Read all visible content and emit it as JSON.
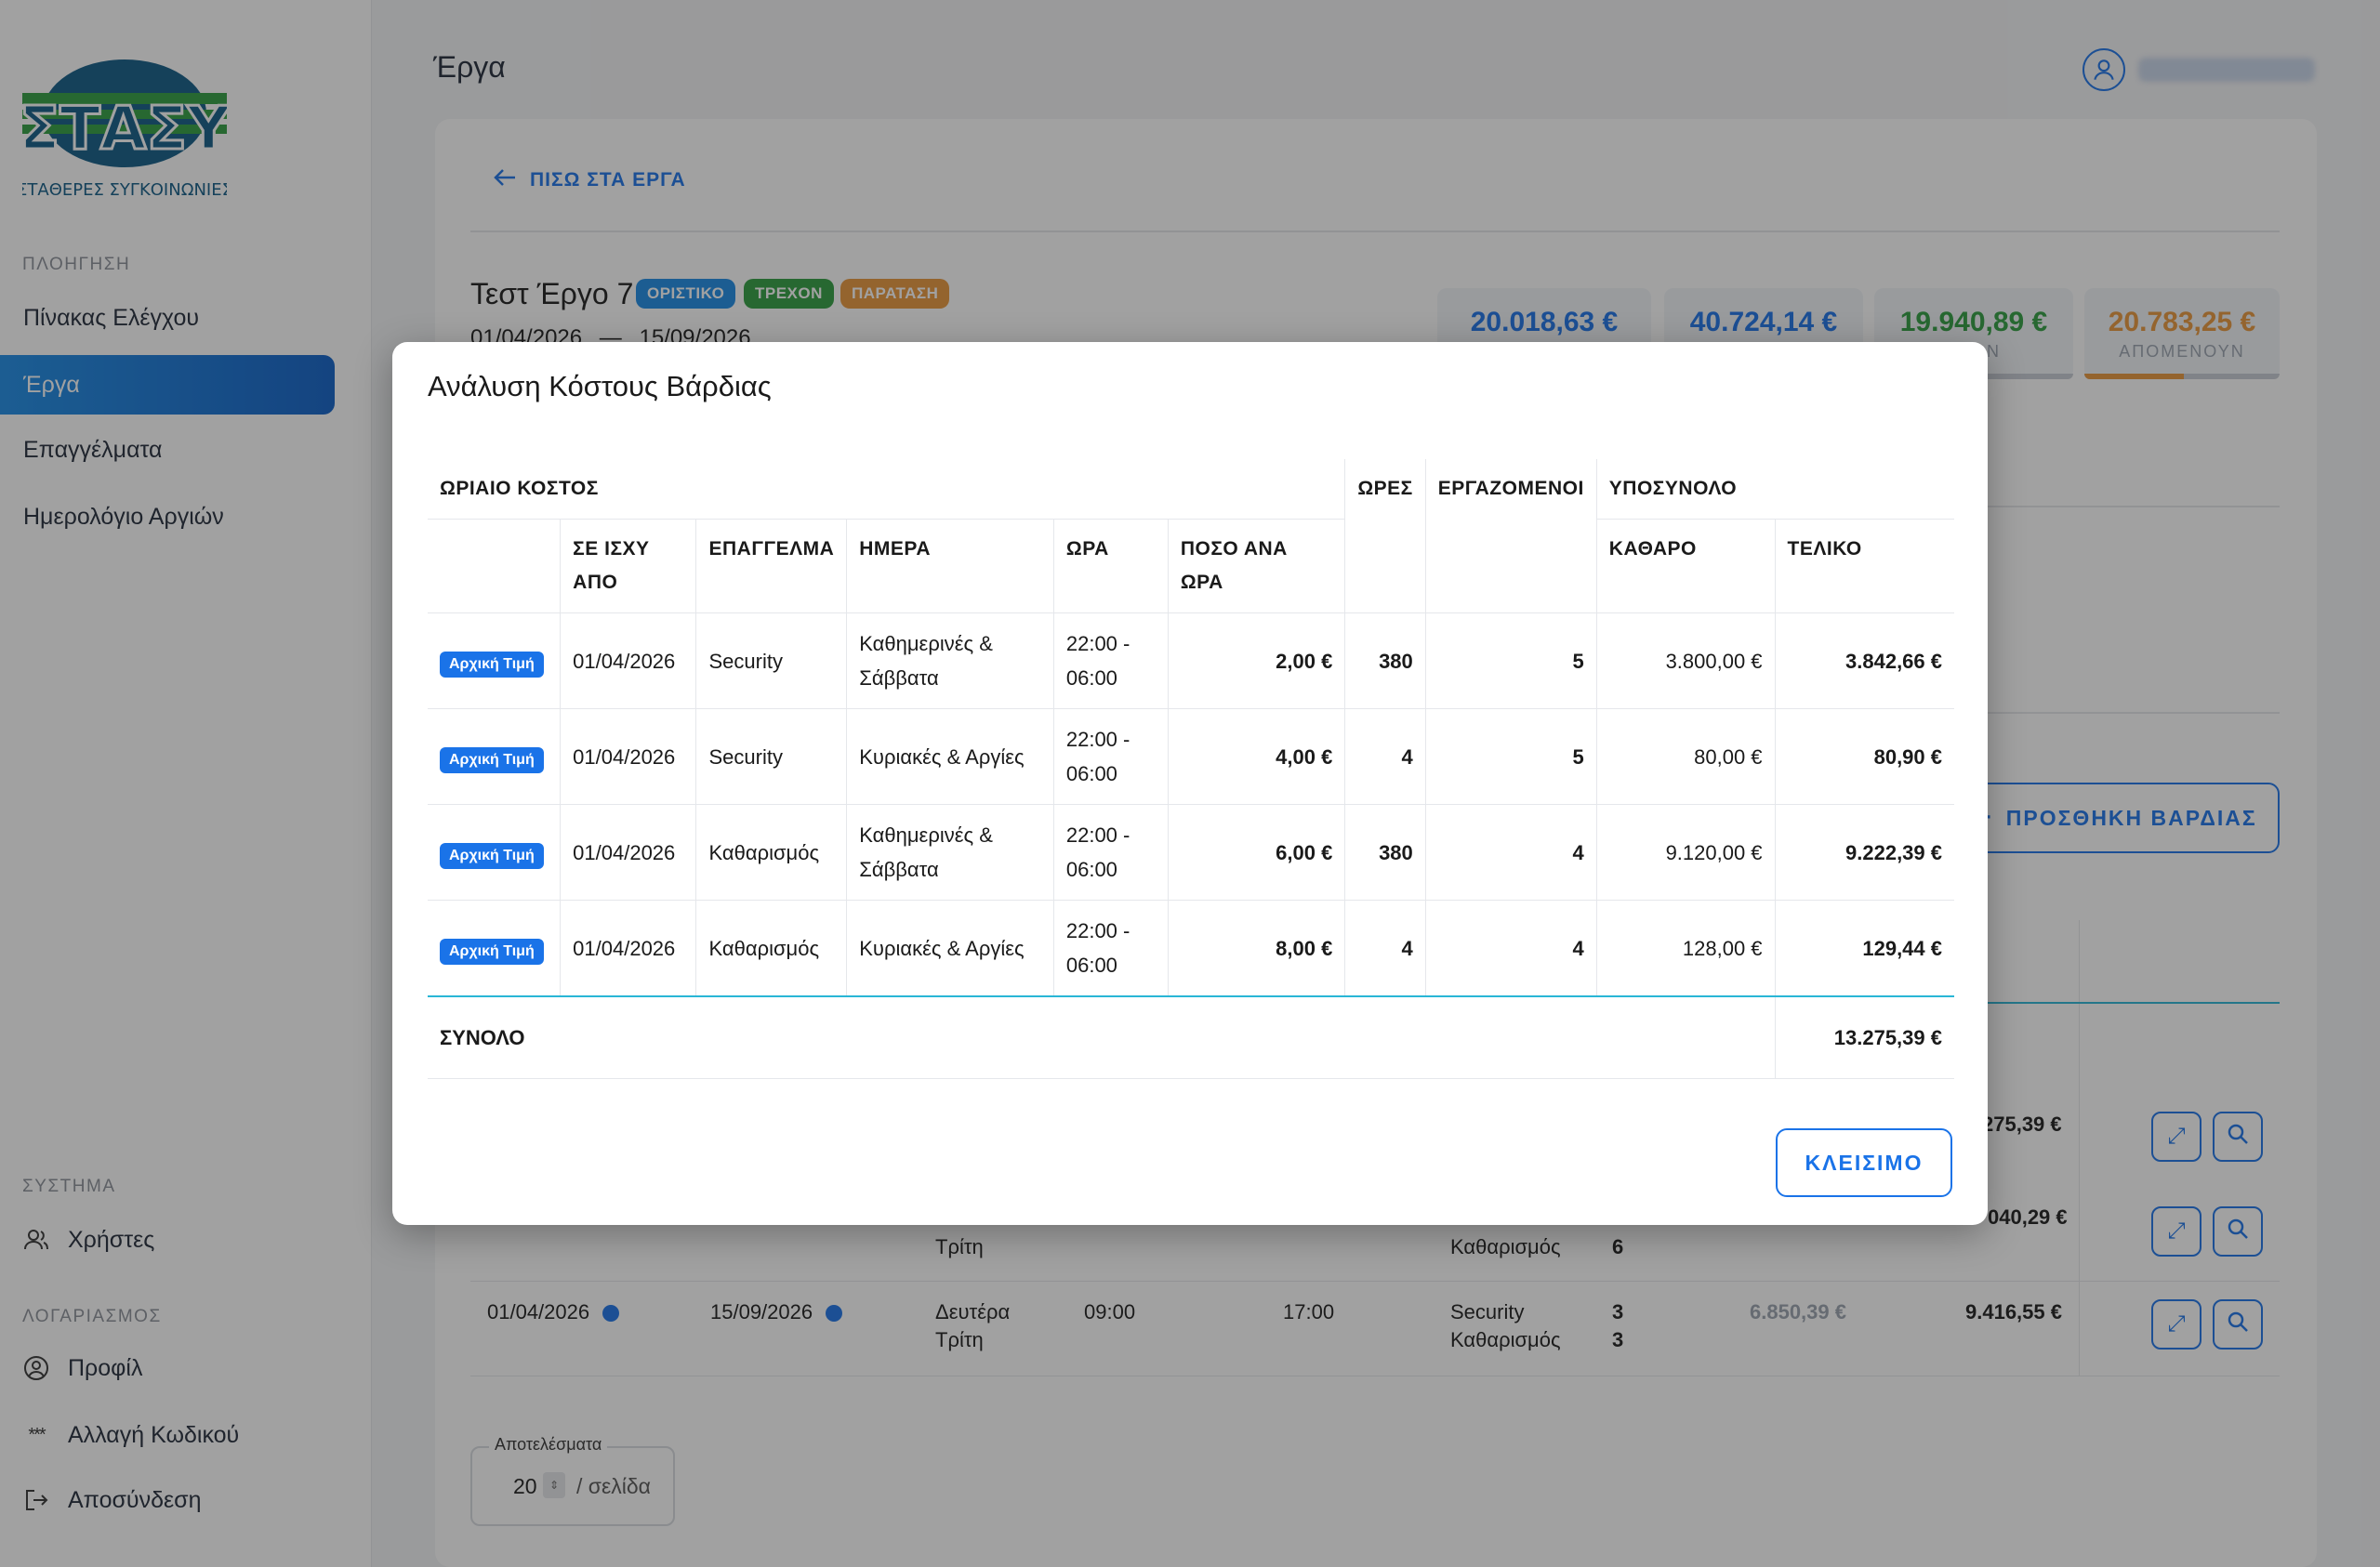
{
  "sidebar": {
    "logo_text": "ΣΤΑΣΥ",
    "logo_subtitle": "ΣΤΑΘΕΡΕΣ ΣΥΓΚΟΙΝΩΝΙΕΣ",
    "nav_section": "ΠΛΟΗΓΗΣΗ",
    "nav": [
      {
        "label": "Πίνακας Ελέγχου"
      },
      {
        "label": "Έργα"
      },
      {
        "label": "Επαγγέλματα"
      },
      {
        "label": "Ημερολόγιο Αργιών"
      }
    ],
    "system_section": "ΣΥΣΤΗΜΑ",
    "system": [
      {
        "label": "Χρήστες",
        "icon": "users-icon"
      }
    ],
    "account_section": "ΛΟΓΑΡΙΑΣΜΟΣ",
    "account": [
      {
        "label": "Προφίλ",
        "icon": "user-circle-icon"
      },
      {
        "label": "Αλλαγή Κωδικού",
        "icon": "password-icon"
      },
      {
        "label": "Αποσύνδεση",
        "icon": "logout-icon"
      }
    ]
  },
  "header": {
    "title": "Έργα"
  },
  "project": {
    "back_label": "ΠΙΣΩ ΣΤΑ ΕΡΓΑ",
    "title": "Τεστ Έργο 7",
    "badges": [
      {
        "label": "ΟΡΙΣΤΙΚΟ",
        "color": "#1a8be6"
      },
      {
        "label": "ΤΡΕΧΟΝ",
        "color": "#2e9e3e"
      },
      {
        "label": "ΠΑΡΑΤΑΣΗ",
        "color": "#e8963a"
      }
    ],
    "date_from": "01/04/2026",
    "date_sep": "—",
    "date_to": "15/09/2026",
    "stats": [
      {
        "value": "20.018,63 €",
        "label": "",
        "color": "#1a73e8"
      },
      {
        "value": "40.724,14 €",
        "label": "",
        "color": "#1a73e8"
      },
      {
        "value": "19.940,89 €",
        "label": "ΗΚΑΝ",
        "color": "#2e9e3e"
      },
      {
        "value": "20.783,25 €",
        "label": "ΑΠΟΜΕΝΟΥΝ",
        "color": "#e8963a",
        "progress": 0.51
      }
    ],
    "add_shift_label": "ΠΡΟΣΘΗΚΗ ΒΑΡΔΙΑΣ"
  },
  "bg_table": {
    "row1_partial": "275,39 €",
    "row2": {
      "day2": "Τρίτη",
      "trade2": "Καθαρισμός",
      "count2": "6",
      "total": "040,29 €"
    },
    "row3": {
      "from": "01/04/2026",
      "to": "15/09/2026",
      "day1": "Δευτέρα",
      "day2": "Τρίτη",
      "start": "09:00",
      "end": "17:00",
      "trade1": "Security",
      "count1": "3",
      "trade2": "Καθαρισμός",
      "count2": "3",
      "net": "6.850,39 €",
      "total": "9.416,55 €"
    },
    "results_label": "Αποτελέσματα",
    "results_value": "20",
    "results_per": "/ σελίδα"
  },
  "modal": {
    "title": "Ανάλυση Κόστους Βάρδιας",
    "headers": {
      "hourly_cost": "ΩΡΙΑΙΟ ΚΟΣΤΟΣ",
      "effective_from": "ΣΕ ΙΣΧΥ ΑΠΟ",
      "trade": "ΕΠΑΓΓΕΛΜΑ",
      "day": "ΗΜΕΡΑ",
      "time": "ΩΡΑ",
      "rate": "ΠΟΣΟ ΑΝΑ ΩΡΑ",
      "hours": "ΩΡΕΣ",
      "workers": "ΕΡΓΑΖΟΜΕΝΟΙ",
      "subtotal": "ΥΠΟΣΥΝΟΛΟ",
      "net": "ΚΑΘΑΡΟ",
      "final": "ΤΕΛΙΚΟ"
    },
    "rows": [
      {
        "tag": "Αρχική Τιμή",
        "from": "01/04/2026",
        "trade": "Security",
        "day": "Καθημερινές & Σάββατα",
        "time": "22:00 - 06:00",
        "rate": "2,00 €",
        "hours": "380",
        "workers": "5",
        "net": "3.800,00 €",
        "final": "3.842,66 €"
      },
      {
        "tag": "Αρχική Τιμή",
        "from": "01/04/2026",
        "trade": "Security",
        "day": "Κυριακές & Αργίες",
        "time": "22:00 - 06:00",
        "rate": "4,00 €",
        "hours": "4",
        "workers": "5",
        "net": "80,00 €",
        "final": "80,90 €"
      },
      {
        "tag": "Αρχική Τιμή",
        "from": "01/04/2026",
        "trade": "Καθαρισμός",
        "day": "Καθημερινές & Σάββατα",
        "time": "22:00 - 06:00",
        "rate": "6,00 €",
        "hours": "380",
        "workers": "4",
        "net": "9.120,00 €",
        "final": "9.222,39 €"
      },
      {
        "tag": "Αρχική Τιμή",
        "from": "01/04/2026",
        "trade": "Καθαρισμός",
        "day": "Κυριακές & Αργίες",
        "time": "22:00 - 06:00",
        "rate": "8,00 €",
        "hours": "4",
        "workers": "4",
        "net": "128,00 €",
        "final": "129,44 €"
      }
    ],
    "total_label": "ΣΥΝΟΛΟ",
    "total_value": "13.275,39 €",
    "close_label": "ΚΛΕΙΣΙΜΟ"
  }
}
